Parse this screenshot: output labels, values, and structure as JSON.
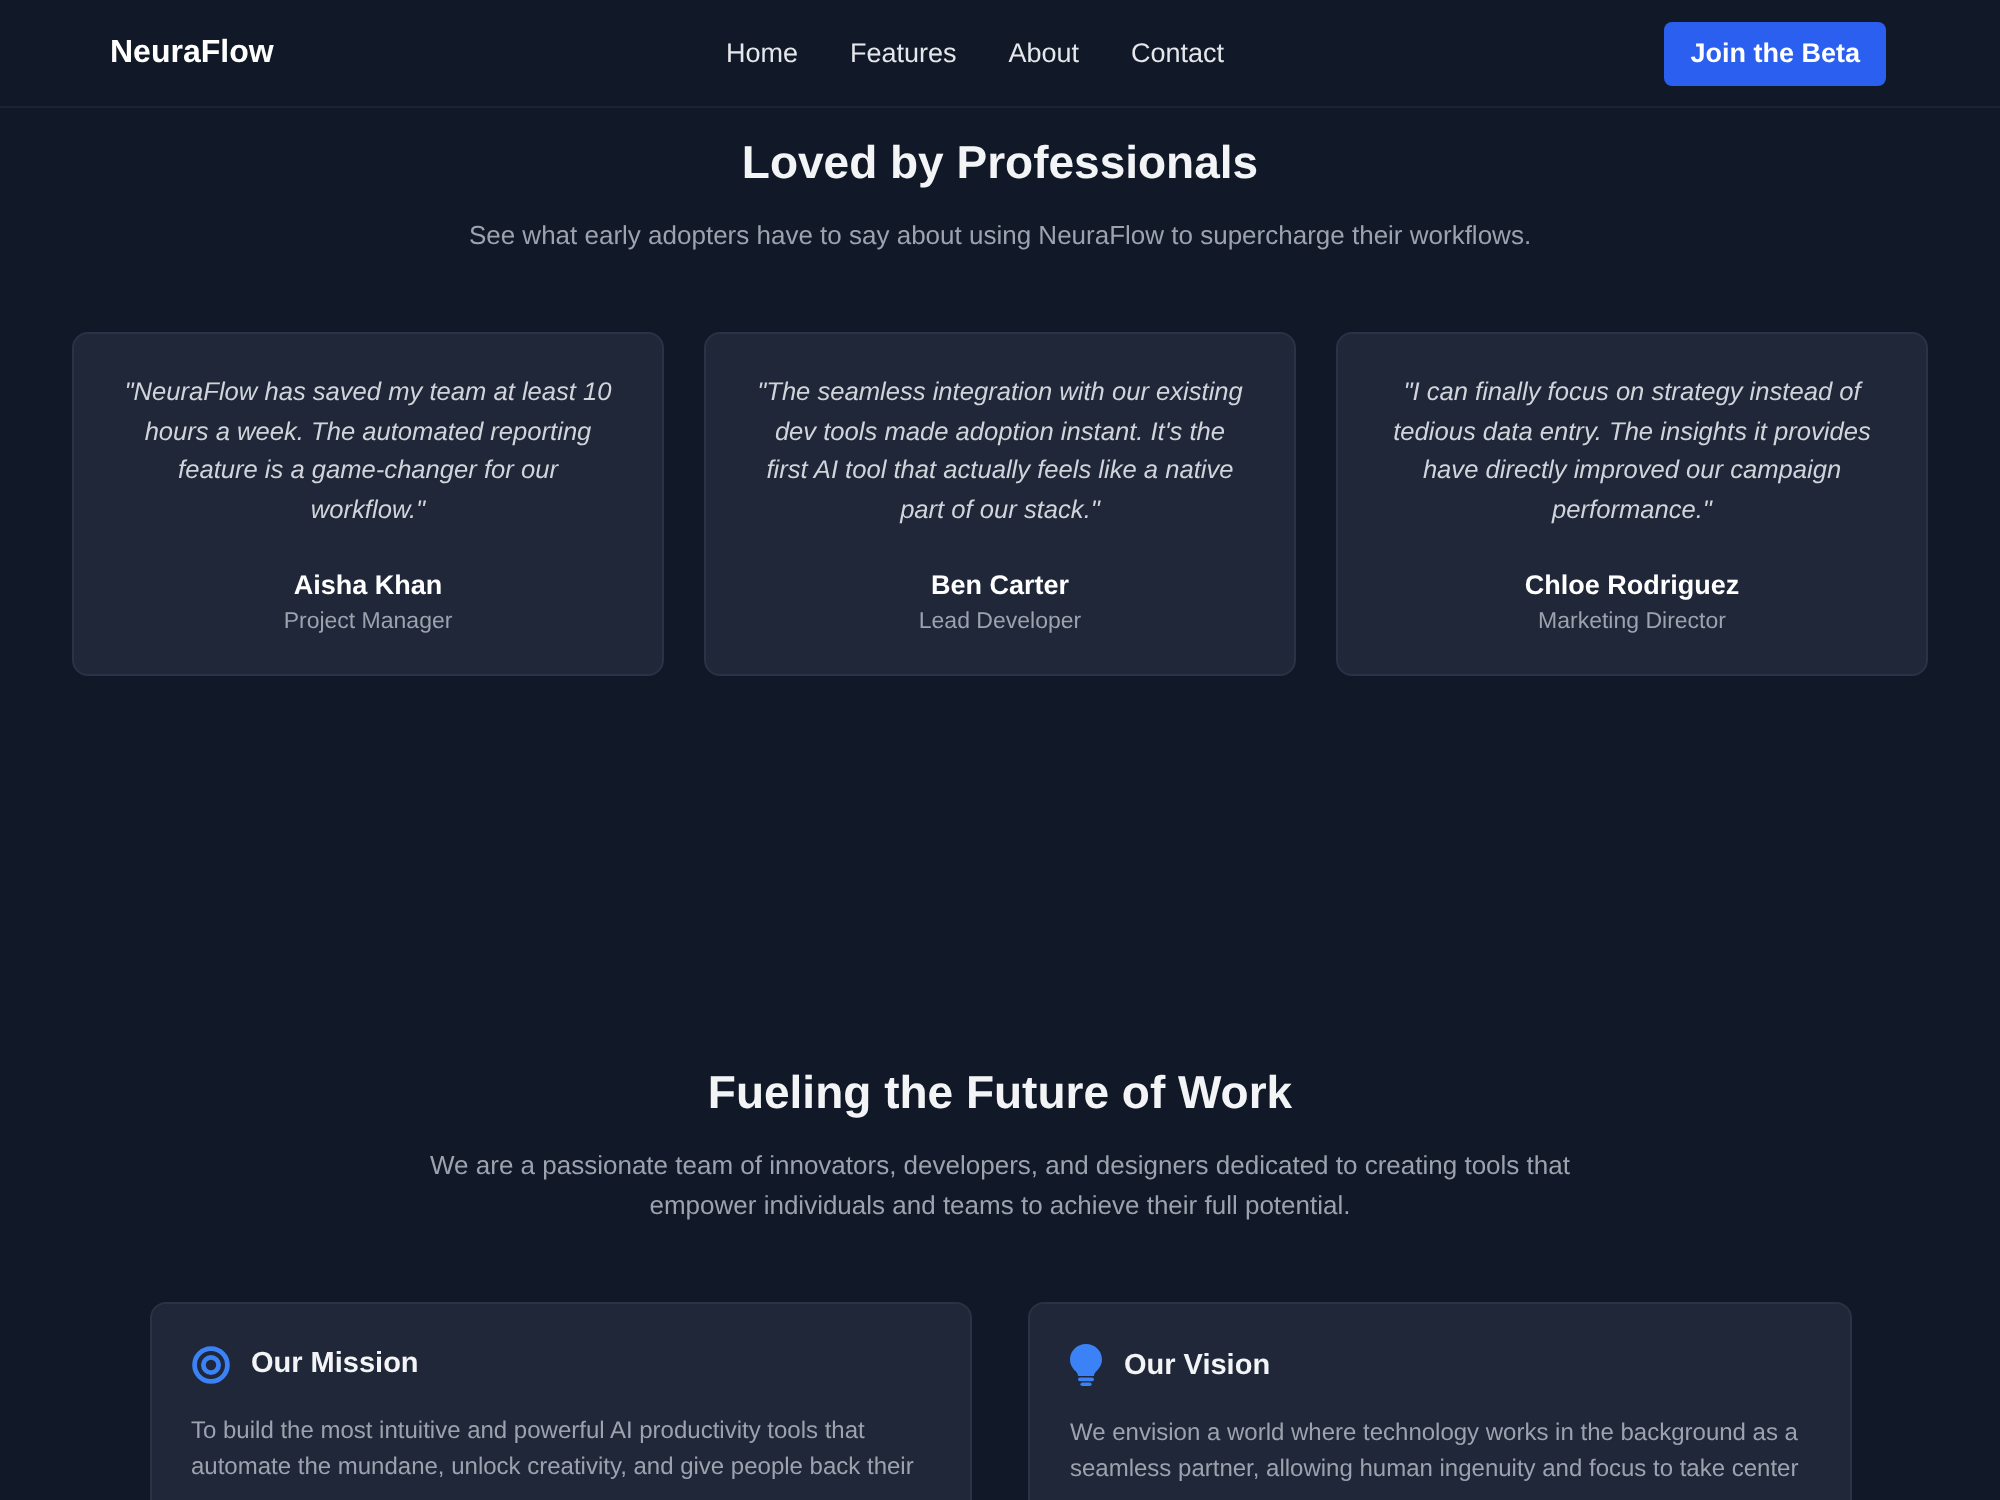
{
  "nav": {
    "logo": "NeuraFlow",
    "links": [
      {
        "label": "Home"
      },
      {
        "label": "Features"
      },
      {
        "label": "About"
      },
      {
        "label": "Contact"
      }
    ],
    "cta": "Join the Beta"
  },
  "testimonials": {
    "title": "Loved by Professionals",
    "subtitle": "See what early adopters have to say about using NeuraFlow to supercharge their workflows.",
    "items": [
      {
        "quote": "\"NeuraFlow has saved my team at least 10 hours a week. The automated reporting feature is a game-changer for our workflow.\"",
        "name": "Aisha Khan",
        "role": "Project Manager"
      },
      {
        "quote": "\"The seamless integration with our existing dev tools made adoption instant. It's the first AI tool that actually feels like a native part of our stack.\"",
        "name": "Ben Carter",
        "role": "Lead Developer"
      },
      {
        "quote": "\"I can finally focus on strategy instead of tedious data entry. The insights it provides have directly improved our campaign performance.\"",
        "name": "Chloe Rodriguez",
        "role": "Marketing Director"
      }
    ]
  },
  "about": {
    "title": "Fueling the Future of Work",
    "text": "We are a passionate team of innovators, developers, and designers dedicated to creating tools that empower individuals and teams to achieve their full potential.",
    "cards": [
      {
        "title": "Our Mission",
        "text": "To build the most intuitive and powerful AI productivity tools that automate the mundane, unlock creativity, and give people back their"
      },
      {
        "title": "Our Vision",
        "text": "We envision a world where technology works in the background as a seamless partner, allowing human ingenuity and focus to take center"
      }
    ]
  }
}
